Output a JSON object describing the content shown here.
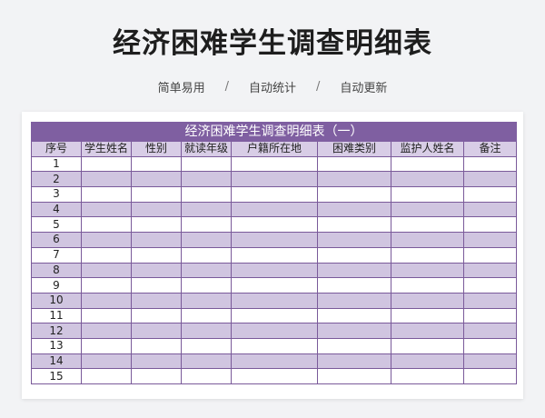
{
  "page_title": "经济困难学生调查明细表",
  "subtitle": {
    "items": [
      "简单易用",
      "自动统计",
      "自动更新"
    ],
    "separator": "/"
  },
  "table": {
    "title": "经济困难学生调查明细表（一）",
    "headers": [
      "序号",
      "学生姓名",
      "性别",
      "就读年级",
      "户籍所在地",
      "困难类别",
      "监护人姓名",
      "备注"
    ],
    "rows": [
      [
        "1",
        "",
        "",
        "",
        "",
        "",
        "",
        ""
      ],
      [
        "2",
        "",
        "",
        "",
        "",
        "",
        "",
        ""
      ],
      [
        "3",
        "",
        "",
        "",
        "",
        "",
        "",
        ""
      ],
      [
        "4",
        "",
        "",
        "",
        "",
        "",
        "",
        ""
      ],
      [
        "5",
        "",
        "",
        "",
        "",
        "",
        "",
        ""
      ],
      [
        "6",
        "",
        "",
        "",
        "",
        "",
        "",
        ""
      ],
      [
        "7",
        "",
        "",
        "",
        "",
        "",
        "",
        ""
      ],
      [
        "8",
        "",
        "",
        "",
        "",
        "",
        "",
        ""
      ],
      [
        "9",
        "",
        "",
        "",
        "",
        "",
        "",
        ""
      ],
      [
        "10",
        "",
        "",
        "",
        "",
        "",
        "",
        ""
      ],
      [
        "11",
        "",
        "",
        "",
        "",
        "",
        "",
        ""
      ],
      [
        "12",
        "",
        "",
        "",
        "",
        "",
        "",
        ""
      ],
      [
        "13",
        "",
        "",
        "",
        "",
        "",
        "",
        ""
      ],
      [
        "14",
        "",
        "",
        "",
        "",
        "",
        "",
        ""
      ],
      [
        "15",
        "",
        "",
        "",
        "",
        "",
        "",
        ""
      ]
    ]
  },
  "colors": {
    "title_bar": "#7f5fa1",
    "header_bg": "#d8cde6",
    "stripe": "#d0c5e0",
    "border": "#7a5a9a"
  }
}
